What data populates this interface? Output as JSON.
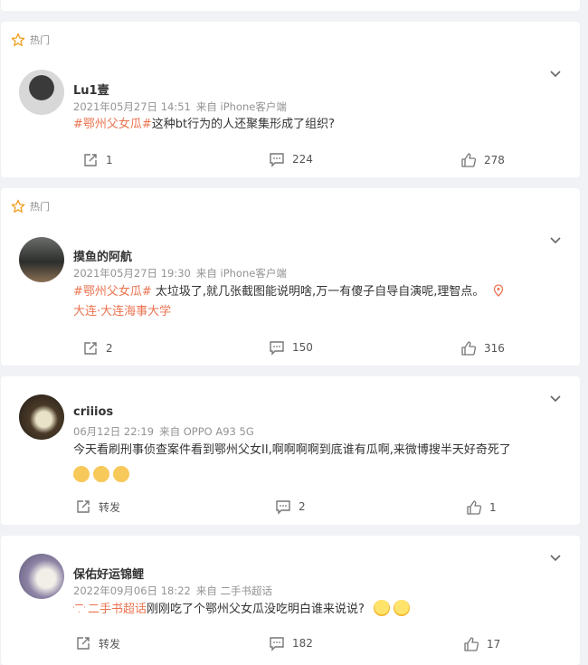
{
  "hot_label": "热门",
  "comments": [
    {
      "name": "Lu1壹",
      "date": "2021年05月27日 14:51",
      "source": "来自 iPhone客户端",
      "topic": "#鄂州父女瓜#",
      "text": "这种bt行为的人还聚集形成了组织?",
      "reposts": "1",
      "replies": "224",
      "likes": "278"
    },
    {
      "name": "摸鱼的阿航",
      "date": "2021年05月27日 19:30",
      "source": "来自 iPhone客户端",
      "topic": "#鄂州父女瓜#",
      "text": " 太垃圾了,就几张截图能说明啥,万一有傻子自导自演呢,理智点。",
      "location": "大连·大连海事大学",
      "reposts": "2",
      "replies": "150",
      "likes": "316"
    },
    {
      "name": "criiios",
      "date": "06月12日 22:19",
      "source": "来自 OPPO A93 5G",
      "text": "今天看刷刑事侦查案件看到鄂州父女II,啊啊啊啊到底谁有瓜啊,来微博搜半天好奇死了",
      "reposts": "转发",
      "replies": "2",
      "likes": "1"
    },
    {
      "name": "保佑好运锦鲤",
      "date": "2022年09月06日 18:22",
      "source": "来自 二手书超话",
      "topic": "二手书超话",
      "text": "刚刚吃了个鄂州父女瓜没吃明白谁来说说?",
      "reposts": "转发",
      "replies": "182",
      "likes": "17"
    }
  ]
}
